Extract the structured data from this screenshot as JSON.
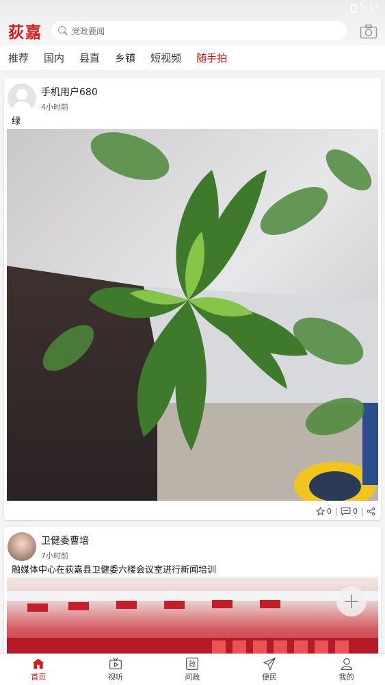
{
  "status": {
    "time": "5:17"
  },
  "header": {
    "logo": "荻嘉",
    "search_placeholder": "党政要闻"
  },
  "tabs": [
    {
      "label": "推荐"
    },
    {
      "label": "国内"
    },
    {
      "label": "县直"
    },
    {
      "label": "乡镇"
    },
    {
      "label": "短视频"
    },
    {
      "label": "随手拍",
      "active": true
    }
  ],
  "posts": [
    {
      "author": "手机用户680",
      "time": "4小时前",
      "text": "绿",
      "likes": "0",
      "comments": "0"
    },
    {
      "author": "卫健委曹培",
      "time": "7小时前",
      "text": "融媒体中心在荻嘉县卫健委六楼会议室进行新闻培训"
    }
  ],
  "bottom_nav": [
    {
      "label": "首页",
      "icon": "home-icon",
      "active": true
    },
    {
      "label": "视听",
      "icon": "tv-icon"
    },
    {
      "label": "问政",
      "icon": "politics-icon"
    },
    {
      "label": "便民",
      "icon": "send-icon"
    },
    {
      "label": "我的",
      "icon": "user-icon"
    }
  ],
  "colors": {
    "accent": "#d11e1e"
  }
}
